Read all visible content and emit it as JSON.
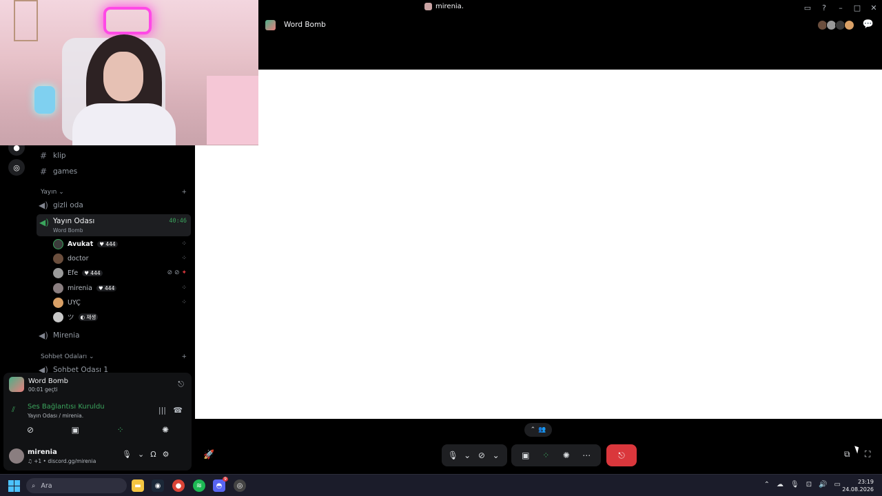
{
  "window": {
    "title": "mirenia.",
    "icons": [
      "inbox-icon",
      "help-icon",
      "minimize-icon",
      "maximize-icon",
      "close-icon"
    ]
  },
  "sidebar": {
    "channels_top": [
      {
        "label": "klip",
        "icon": "hash-icon"
      },
      {
        "label": "games",
        "icon": "hash-icon"
      }
    ],
    "category_yayin": "Yayın",
    "voice_channels": {
      "gizli": "gizli oda",
      "active": {
        "label": "Yayın Odası",
        "sub": "Word Bomb",
        "timer": "40:46"
      },
      "mirenia": "Mirenia"
    },
    "members": [
      {
        "name": "Avukat",
        "badge": "♥ 444",
        "bold": true
      },
      {
        "name": "doctor",
        "badge": ""
      },
      {
        "name": "Efe",
        "badge": "♥ 444"
      },
      {
        "name": "mirenia",
        "badge": "♥ 444"
      },
      {
        "name": "UYÇ",
        "badge": ""
      },
      {
        "name": "ツ",
        "badge": "◐ 재생"
      }
    ],
    "category_sohbet": "Sohbet Odaları",
    "sohbet_first": "Sohbet Odası 1"
  },
  "panel": {
    "activity_title": "Word Bomb",
    "activity_elapsed": "00:01 geçti",
    "voice_status": "Ses Bağlantısı Kuruldu",
    "voice_location": "Yayın Odası / mirenia.",
    "user_name": "mirenia",
    "user_status": "♫ +1 • discord.gg/mirenia"
  },
  "main": {
    "header_title": "Word Bomb"
  },
  "taskbar": {
    "search_placeholder": "Ara",
    "time": "23:19",
    "date": "24.08.2026",
    "discord_badge": "9"
  },
  "colors": {
    "accent_green": "#3ba55d",
    "danger_red": "#da373c",
    "neon_pink": "#ff49e6"
  }
}
